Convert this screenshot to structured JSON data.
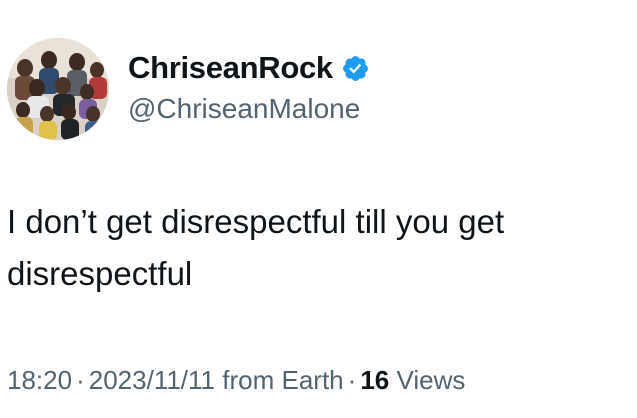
{
  "author": {
    "display_name": "ChriseanRock",
    "handle": "@ChriseanMalone",
    "avatar_icon": "family-group-photo",
    "verified_icon": "verified-badge-icon",
    "verified_color": "#1d9bf0"
  },
  "tweet": {
    "text": "I don’t get disrespectful till you get disrespectful"
  },
  "meta": {
    "time": "18:20",
    "separator": "·",
    "date": "2023/11/11",
    "location": "from Earth",
    "views_count": "16",
    "views_label": "Views"
  },
  "colors": {
    "text_primary": "#0f1419",
    "text_secondary": "#536471",
    "background": "#ffffff"
  }
}
